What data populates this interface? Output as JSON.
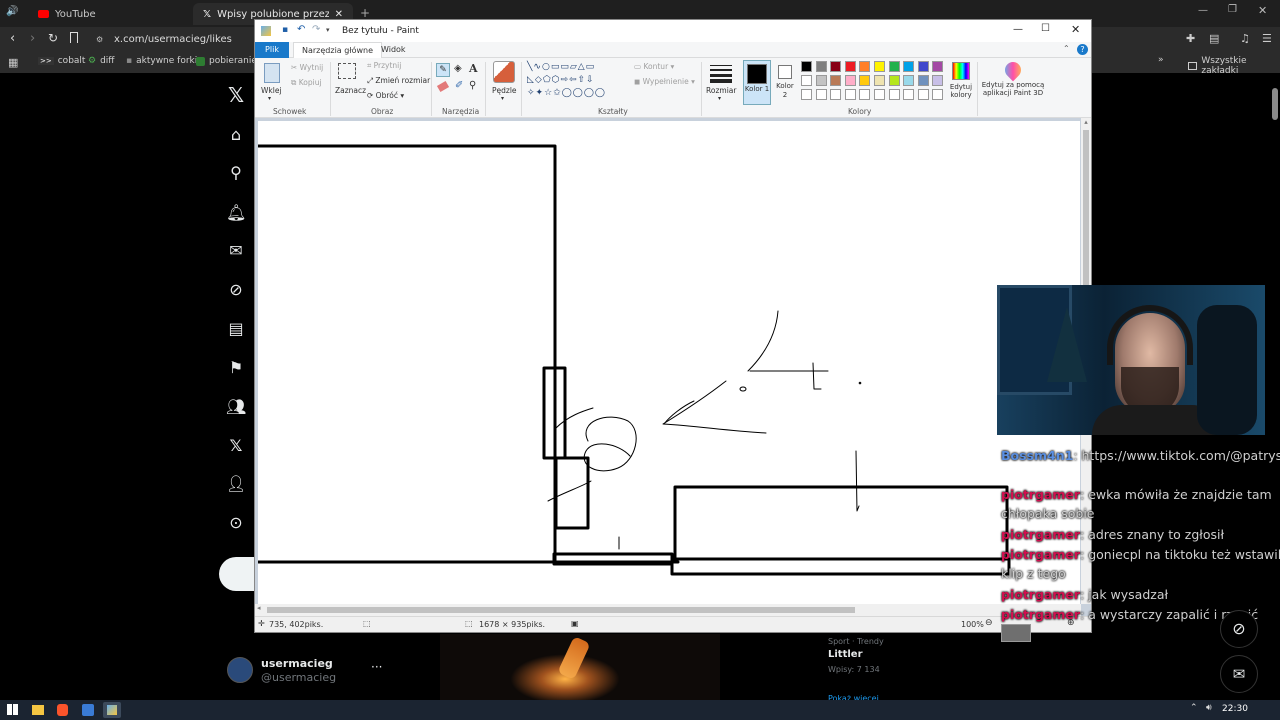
{
  "browser": {
    "tabs": [
      {
        "label": "YouTube"
      },
      {
        "label": "Wpisy polubione przez usermac"
      }
    ],
    "url": "x.com/usermacieg/likes",
    "bookmarks": [
      "cobalt",
      "diff",
      "aktywne forki",
      "pobieranie s"
    ],
    "bookmarks_right": "Wszystkie zakładki"
  },
  "x": {
    "profile_name": "usermacieg",
    "profile_handle": "@usermacieg",
    "trend_meta": "Sport · Trendy",
    "trend_title": "Littler",
    "trend_count": "Wpisy: 7 134",
    "show_more": "Pokaż więcej"
  },
  "paint": {
    "title": "Bez tytułu - Paint",
    "tabs": {
      "file": "Plik",
      "home": "Narzędzia główne",
      "view": "Widok"
    },
    "clipboard": {
      "paste": "Wklej",
      "cut": "Wytnij",
      "copy": "Kopiuj",
      "label": "Schowek"
    },
    "image": {
      "select": "Zaznacz",
      "crop": "Przytnij",
      "resize": "Zmień rozmiar",
      "rotate": "Obróć",
      "label": "Obraz"
    },
    "tools": {
      "label": "Narzędzia"
    },
    "brushes": {
      "label": "Pędzle"
    },
    "shapes": {
      "outline": "Kontur",
      "fill": "Wypełnienie",
      "label": "Kształty"
    },
    "size": {
      "label": "Rozmiar"
    },
    "colors": {
      "color1": "Kolor 1",
      "color2": "Kolor 2",
      "edit": "Edytuj kolory",
      "paint3d": "Edytuj za pomocą aplikacji Paint 3D",
      "label": "Kolory",
      "color1_value": "#000000",
      "color2_value": "#ffffff",
      "palette_row1": [
        "#000000",
        "#7f7f7f",
        "#880015",
        "#ed1c24",
        "#ff7f27",
        "#fff200",
        "#22b14c",
        "#00a2e8",
        "#3f48cc",
        "#a349a4"
      ],
      "palette_row2": [
        "#ffffff",
        "#c3c3c3",
        "#b97a57",
        "#ffaec9",
        "#ffc90e",
        "#efe4b0",
        "#b5e61d",
        "#99d9ea",
        "#7092be",
        "#c8bfe7"
      ]
    },
    "status": {
      "cursor": "735, 402piks.",
      "dimensions": "1678 × 935piks.",
      "zoom": "100%"
    }
  },
  "chat": [
    {
      "user": "Bossm4n1",
      "text": ": https://www.tiktok.com/@patrysi",
      "color": "#5b8fe0"
    },
    {
      "user": "piotrgamer",
      "text": ": ewka mówiła że znajdzie tam",
      "cont": "chłopaka sobie"
    },
    {
      "user": "piotrgamer",
      "text": ": adres znany to zgłosił"
    },
    {
      "user": "piotrgamer",
      "text": ": goniecpl na tiktoku też wstawil",
      "cont": "klip z tego"
    },
    {
      "user": "piotrgamer",
      "text": ": jak wysadzał"
    },
    {
      "user": "piotrgamer",
      "text": ": a wystarczy zapalić i rzucić"
    }
  ],
  "taskbar": {
    "time": "22:30"
  }
}
